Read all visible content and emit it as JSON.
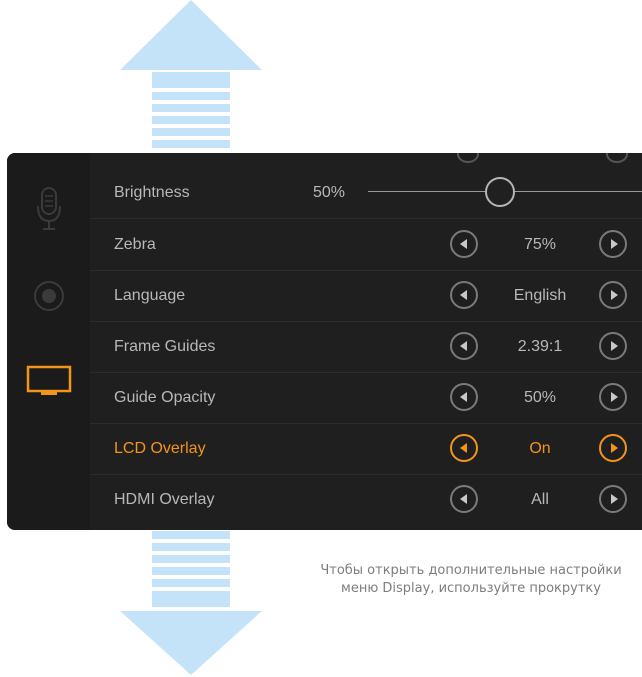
{
  "colors": {
    "accent": "#f3941d",
    "arrow": "#c4e3f9",
    "text": "#b8b8b8",
    "background": "#1f1f1f"
  },
  "sidebar": {
    "icons": [
      "microphone-icon",
      "record-icon",
      "display-icon"
    ],
    "active": "display-icon"
  },
  "menu": {
    "brightness": {
      "label": "Brightness",
      "value": "50%",
      "level": 0.5
    },
    "rows": [
      {
        "label": "Zebra",
        "value": "75%"
      },
      {
        "label": "Language",
        "value": "English"
      },
      {
        "label": "Frame Guides",
        "value": "2.39:1"
      },
      {
        "label": "Guide Opacity",
        "value": "50%"
      },
      {
        "label": "LCD Overlay",
        "value": "On"
      },
      {
        "label": "HDMI Overlay",
        "value": "All"
      }
    ]
  },
  "caption": {
    "line1": "Чтобы открыть дополнительные настройки",
    "line2": "меню Display, используйте прокрутку"
  }
}
